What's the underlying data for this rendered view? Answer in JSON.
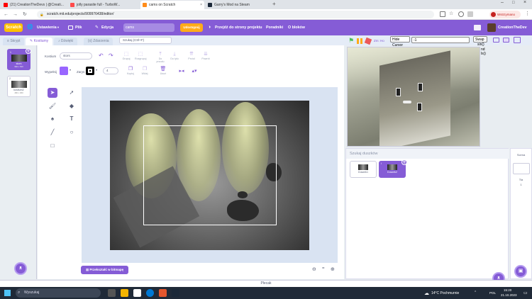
{
  "browser": {
    "tabs": [
      {
        "title": "(21) CreationTheDevs | @Creati...",
        "color": "#ff0000",
        "active": false
      },
      {
        "title": "jolly parasite full - TurboW...",
        "color": "#ff4b4b",
        "active": false
      },
      {
        "title": "cams on Scratch",
        "color": "#ff8c1a",
        "active": true
      },
      {
        "title": "Garry's Mod na Steam",
        "color": "#1b2838",
        "active": false
      }
    ],
    "url": "scratch.mit.edu/projects/909976438/editor/",
    "profile_label": "Wstrzymano",
    "nav_back": "←",
    "nav_forward": "→",
    "nav_reload": "↻",
    "lock": "🔒"
  },
  "menu": {
    "logo": "Scratch",
    "settings": "Ustawienia",
    "file": "Plik",
    "edit": "Edycja",
    "project_title": "cams",
    "share": "Udostępnij",
    "see_project": "Przejdź do strony projektu",
    "tutorials": "Poradniki",
    "my_stuff": "O bloków",
    "username": "CreationTheDev"
  },
  "editor_tabs": {
    "code": "Skrypt",
    "costumes": "Kostiumy",
    "sounds": "Dźwięki",
    "extensions": "Zdarzenia"
  },
  "costumes": [
    {
      "index": "1",
      "name": "stors",
      "size": "960 x 540",
      "selected": true
    },
    {
      "index": "2",
      "name": "kostium2",
      "size": "480 x 360",
      "selected": false
    }
  ],
  "paint": {
    "costume_label": "Kostium",
    "costume_name": "stors",
    "search_placeholder": "Szukaj (Ctrl+F)",
    "fill_label": "Wypełnij",
    "fill_color": "#9966ff",
    "outline_label": "Zarys",
    "outline_width": "4",
    "toolbar": [
      {
        "label": "Grupuj",
        "glyph": "⬚",
        "dim": true
      },
      {
        "label": "Rozgrupuj",
        "glyph": "⬚",
        "dim": true
      },
      {
        "label": "Do przodu",
        "glyph": "⤒",
        "dim": true
      },
      {
        "label": "Do tyłu",
        "glyph": "⤓",
        "dim": true
      },
      {
        "label": "Przód",
        "glyph": "⇈",
        "dim": true
      },
      {
        "label": "Powrót",
        "glyph": "⇊",
        "dim": true
      }
    ],
    "row2": [
      {
        "label": "Kopiuj",
        "glyph": "❐"
      },
      {
        "label": "Wklej",
        "glyph": "❐"
      },
      {
        "label": "Usuń",
        "glyph": "🗑"
      },
      {
        "label": "",
        "glyph": "▸◂"
      },
      {
        "label": "",
        "glyph": "▴▾"
      }
    ],
    "tools": [
      "select",
      "reshape",
      "brush",
      "eraser",
      "fill",
      "text",
      "line",
      "circle",
      "rect"
    ],
    "convert_button": "Przekształć w bitmapę",
    "zoom_out": "⊖",
    "zoom_reset": "=",
    "zoom_in": "⊕"
  },
  "stage": {
    "hide_cursor": "Hide Cursor",
    "swap": "Swap",
    "swap_sub": "sin()",
    "input_value": "-1",
    "var_label": "Zm: Ho",
    "var_extra": "nd",
    "var_extra2": "ls()"
  },
  "sprites": {
    "search_placeholder": "Szukaj duszków",
    "items": [
      {
        "name": "Duszek1",
        "selected": false
      },
      {
        "name": "Duszek2",
        "selected": true
      }
    ],
    "backdrop_label": "Scena",
    "backdrop_count_label": "Tła",
    "backdrop_count": "1"
  },
  "backpack_label": "Plecak",
  "taskbar": {
    "search": "Wyszukaj",
    "weather": "14°C Pochmurnie",
    "lang": "POL",
    "time": "15:20",
    "date": "21.10.2023"
  }
}
